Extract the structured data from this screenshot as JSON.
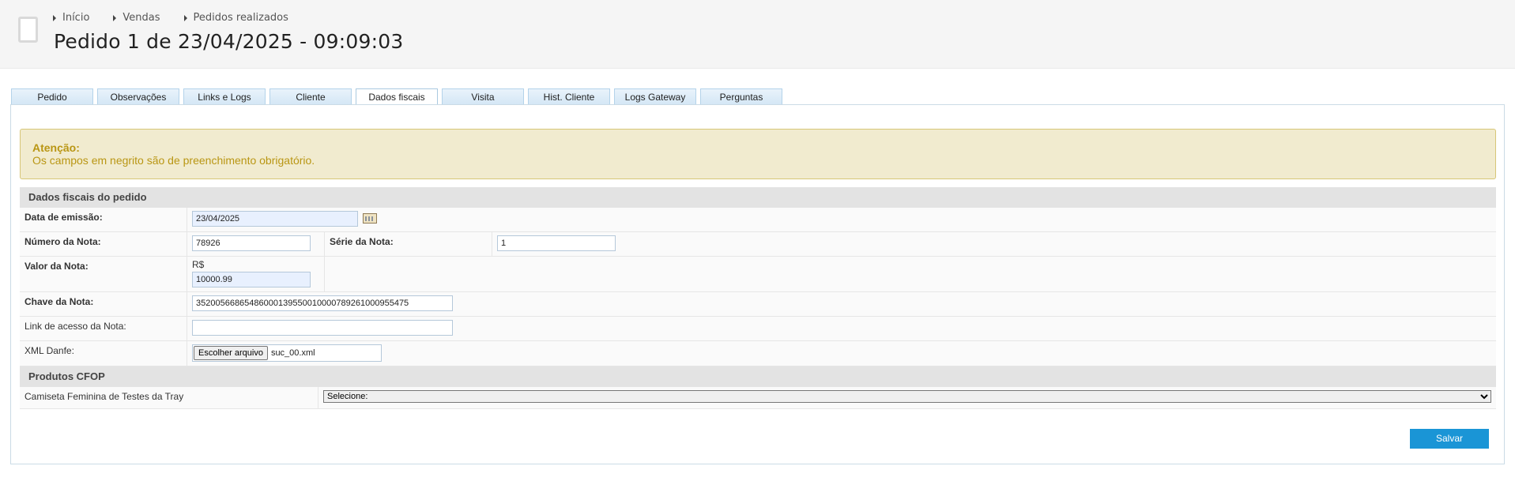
{
  "breadcrumb": [
    "Início",
    "Vendas",
    "Pedidos realizados"
  ],
  "page_title": "Pedido 1 de 23/04/2025 - 09:09:03",
  "tabs": [
    {
      "label": "Pedido"
    },
    {
      "label": "Observações"
    },
    {
      "label": "Links e Logs"
    },
    {
      "label": "Cliente"
    },
    {
      "label": "Dados fiscais"
    },
    {
      "label": "Visita"
    },
    {
      "label": "Hist. Cliente"
    },
    {
      "label": "Logs Gateway"
    },
    {
      "label": "Perguntas"
    }
  ],
  "active_tab": "Dados fiscais",
  "alert": {
    "title": "Atenção:",
    "message": "Os campos em negrito são de preenchimento obrigatório."
  },
  "form": {
    "section_title": "Dados fiscais do pedido",
    "data_emissao": {
      "label": "Data de emissão:",
      "value": "23/04/2025"
    },
    "numero_nota": {
      "label": "Número da Nota:",
      "value": "78926"
    },
    "serie_nota": {
      "label": "Série da Nota:",
      "value": "1"
    },
    "valor_nota": {
      "label": "Valor da Nota:",
      "currency": "R$",
      "value": "10000.99"
    },
    "chave_nota": {
      "label": "Chave da Nota:",
      "value": "35200566865486000139550010000789261000955475"
    },
    "link_nota": {
      "label": "Link de acesso da Nota:",
      "value": ""
    },
    "xml_danfe": {
      "label": "XML Danfe:",
      "button": "Escolher arquivo",
      "filename": "suc_00.xml"
    }
  },
  "produtos": {
    "section_title": "Produtos CFOP",
    "items": [
      {
        "name": "Camiseta Feminina de Testes da Tray",
        "selected": "Selecione:"
      }
    ]
  },
  "save_button": "Salvar",
  "colors": {
    "accent": "#1a95d6",
    "alert_bg": "#f1ebcf",
    "alert_text": "#b99613",
    "tab_border": "#b4d3ea"
  }
}
